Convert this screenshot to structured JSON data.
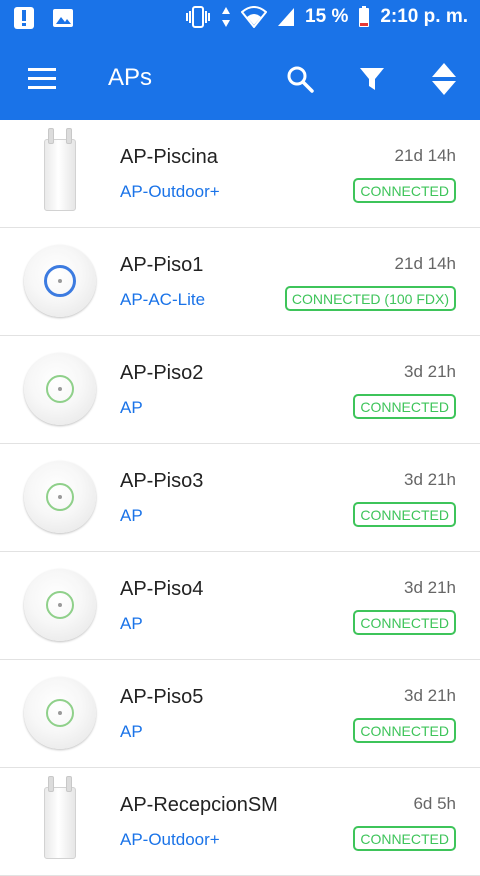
{
  "status_bar": {
    "battery_percent": "15 %",
    "time": "2:10 p. m."
  },
  "app_bar": {
    "title": "APs",
    "icons": [
      "menu-icon",
      "search-icon",
      "filter-icon",
      "sort-icon"
    ]
  },
  "colors": {
    "primary": "#1a73e8",
    "connected": "#3ec45a"
  },
  "aps": [
    {
      "name": "AP-Piscina",
      "model": "AP-Outdoor+",
      "uptime": "21d 14h",
      "status": "CONNECTED",
      "device": "outdoor"
    },
    {
      "name": "AP-Piso1",
      "model": "AP-AC-Lite",
      "uptime": "21d 14h",
      "status": "CONNECTED (100 FDX)",
      "device": "disc-lite"
    },
    {
      "name": "AP-Piso2",
      "model": "AP",
      "uptime": "3d 21h",
      "status": "CONNECTED",
      "device": "disc"
    },
    {
      "name": "AP-Piso3",
      "model": "AP",
      "uptime": "3d 21h",
      "status": "CONNECTED",
      "device": "disc"
    },
    {
      "name": "AP-Piso4",
      "model": "AP",
      "uptime": "3d 21h",
      "status": "CONNECTED",
      "device": "disc"
    },
    {
      "name": "AP-Piso5",
      "model": "AP",
      "uptime": "3d 21h",
      "status": "CONNECTED",
      "device": "disc"
    },
    {
      "name": "AP-RecepcionSM",
      "model": "AP-Outdoor+",
      "uptime": "6d 5h",
      "status": "CONNECTED",
      "device": "outdoor"
    }
  ]
}
